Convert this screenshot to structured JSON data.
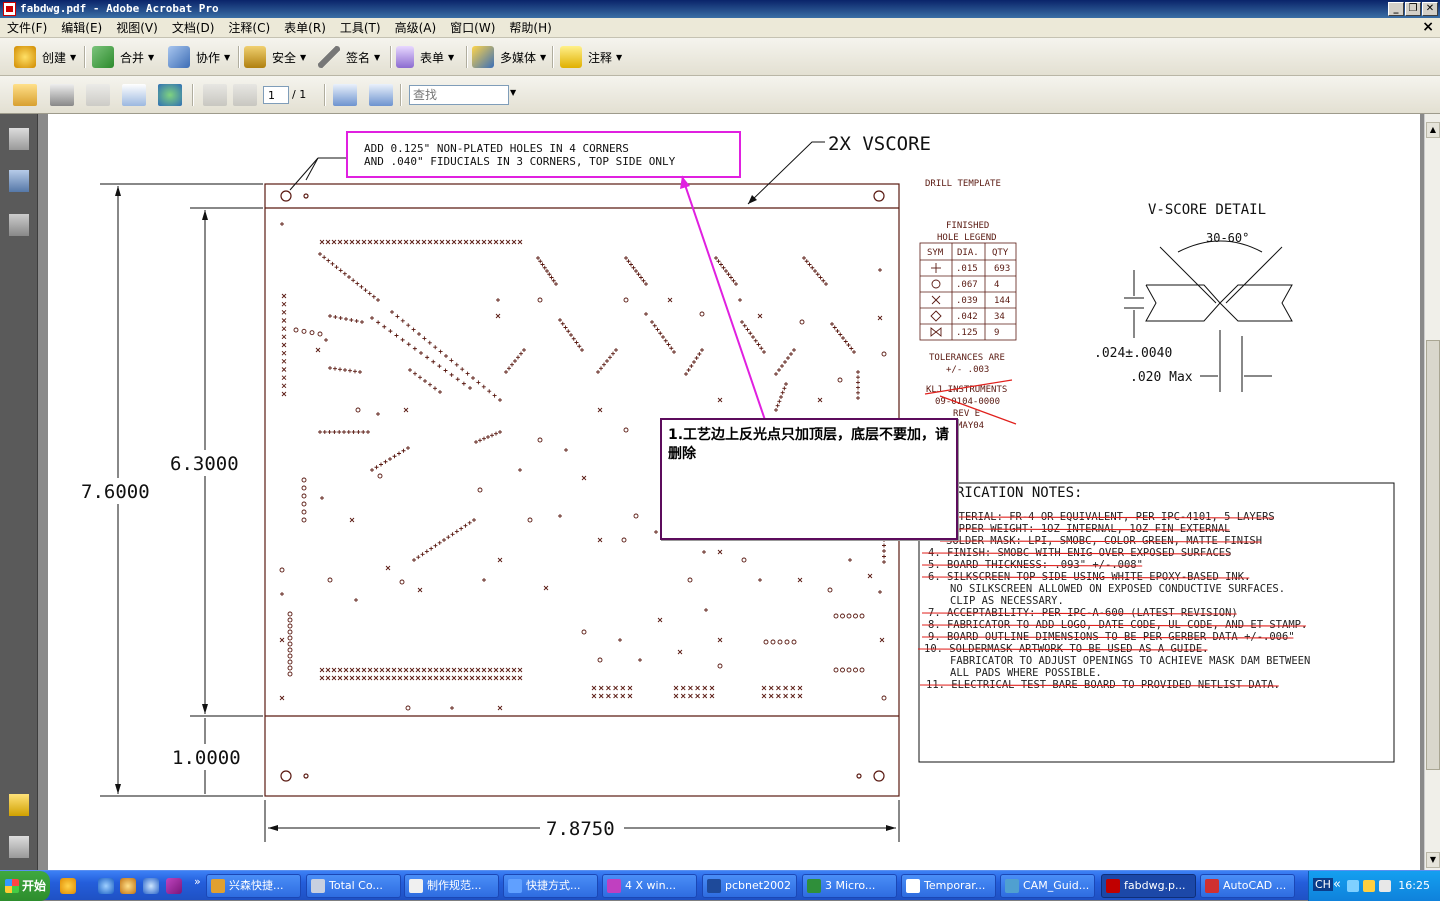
{
  "window": {
    "title": "fabdwg.pdf - Adobe Acrobat Pro"
  },
  "menubar": [
    "文件(F)",
    "编辑(E)",
    "视图(V)",
    "文档(D)",
    "注释(C)",
    "表单(R)",
    "工具(T)",
    "高级(A)",
    "窗口(W)",
    "帮助(H)"
  ],
  "toolbar": {
    "create": "创建",
    "combine": "合并",
    "collaborate": "协作",
    "secure": "安全",
    "sign": "签名",
    "forms": "表单",
    "multimedia": "多媒体",
    "comment": "注释"
  },
  "nav": {
    "page_current": "1",
    "page_total": "/ 1",
    "search_placeholder": "查找"
  },
  "drawing": {
    "note_holes_line1": "ADD 0.125\" NON-PLATED HOLES IN 4 CORNERS",
    "note_holes_line2": "AND .040\" FIDUCIALS IN 3 CORNERS, TOP SIDE ONLY",
    "vscore_label": "2X  VSCORE",
    "dim_height_total": "7.6000",
    "dim_height_inner": "6.3000",
    "dim_height_bottom": "1.0000",
    "dim_width": "7.8750",
    "drill_template": "DRILL TEMPLATE",
    "legend_title1": "FINISHED",
    "legend_title2": "HOLE LEGEND",
    "legend_headers": [
      "SYM",
      "DIA.",
      "QTY"
    ],
    "legend_rows": [
      {
        "sym": "plus",
        "dia": ".015",
        "qty": "693"
      },
      {
        "sym": "circle",
        "dia": ".067",
        "qty": "4"
      },
      {
        "sym": "x",
        "dia": ".039",
        "qty": "144"
      },
      {
        "sym": "diamond",
        "dia": ".042",
        "qty": "34"
      },
      {
        "sym": "bowtie",
        "dia": ".125",
        "qty": "9"
      }
    ],
    "tolerances1": "TOLERANCES ARE",
    "tolerances2": "+/- .003",
    "company1": "KLJ INSTRUMENTS",
    "company2": "09-0104-0000",
    "company3": "REV E",
    "company4": "MAY04",
    "vscore_detail_title": "V-SCORE DETAIL",
    "vscore_angle": "30-60°",
    "vscore_depth": ".024±.0040",
    "vscore_max": ".020 Max",
    "fab_notes_title": "RICATION NOTES:",
    "fab_notes": [
      "MATERIAL: FR-4 OR EQUIVALENT, PER IPC-4101, 5 LAYERS",
      "COPPER WEIGHT: 1OZ INTERNAL, 1OZ FIN EXTERNAL",
      "SOLDER MASK: LPI, SMOBC, COLOR GREEN, MATTE FINISH",
      "4. FINISH: SMOBC WITH ENIG OVER EXPOSED SURFACES",
      "5. BOARD THICKNESS: .093\" +/-.008\"",
      "6. SILKSCREEN TOP SIDE USING WHITE EPOXY-BASED INK.",
      "NO SILKSCREEN ALLOWED ON EXPOSED CONDUCTIVE SURFACES.",
      "CLIP AS NECESSARY.",
      "7. ACCEPTABILITY: PER IPC-A-600 (LATEST REVISION)",
      "8. FABRICATOR TO ADD LOGO, DATE CODE, UL CODE, AND ET STAMP.",
      "9. BOARD OUTLINE DIMENSIONS TO BE PER GERBER DATA +/-.006\"",
      "10. SOLDERMASK ARTWORK TO BE USED AS A GUIDE.",
      "FABRICATOR TO ADJUST OPENINGS TO ACHIEVE MASK DAM BETWEEN",
      "ALL PADS WHERE POSSIBLE.",
      "11. ELECTRICAL TEST BARE BOARD TO PROVIDED NETLIST DATA."
    ]
  },
  "comment": {
    "text": "1.工艺边上反光点只加顶层，底层不要加，请删除"
  },
  "taskbar": {
    "start": "开始",
    "tasks": [
      "兴森快捷...",
      "Total Co...",
      "制作规范...",
      "快捷方式...",
      "4 X win...",
      "pcbnet2002",
      "3 Micro...",
      "Temporar...",
      "CAM_Guid...",
      "fabdwg.p...",
      "AutoCAD ..."
    ],
    "lang": "CH",
    "clock": "16:25"
  },
  "colors": {
    "drawing": "#5a1a12",
    "markup_red": "#e0201c",
    "markup_magenta": "#e020e0",
    "title_blue": "#0a246a"
  }
}
